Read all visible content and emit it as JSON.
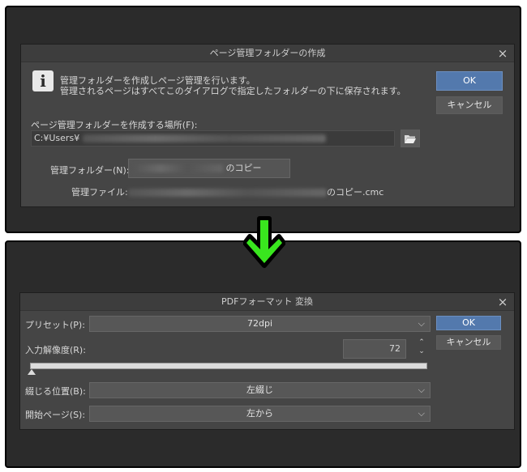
{
  "dialog1": {
    "title": "ページ管理フォルダーの作成",
    "message_line1": "管理フォルダーを作成しページ管理を行います。",
    "message_line2": "管理されるページはすべてこのダイアログで指定したフォルダーの下に保存されます。",
    "ok_label": "OK",
    "cancel_label": "キャンセル",
    "location_label": "ページ管理フォルダーを作成する場所(F):",
    "location_value": "C:¥Users¥",
    "folder_label": "管理フォルダー(N):",
    "folder_suffix": "のコピー",
    "file_label": "管理ファイル:",
    "file_suffix": "のコピー.cmc"
  },
  "dialog2": {
    "title": "PDFフォーマット 変換",
    "ok_label": "OK",
    "cancel_label": "キャンセル",
    "preset_label": "プリセット(P):",
    "preset_value": "72dpi",
    "resolution_label": "入力解像度(R):",
    "resolution_value": "72",
    "resolution_slider_fraction": 0.0,
    "binding_label": "綴じる位置(B):",
    "binding_value": "左綴じ",
    "start_page_label": "開始ページ(S):",
    "start_page_value": "左から"
  },
  "icons": {
    "info": "info-icon",
    "close": "close-icon",
    "folder": "folder-open-icon",
    "arrow": "arrow-down-icon",
    "chevron": "chevron-down-icon",
    "spin": "spin-updown-icon"
  },
  "colors": {
    "accent": "#5379ad",
    "arrow": "#39e61e",
    "dialog_bg": "#454545"
  }
}
